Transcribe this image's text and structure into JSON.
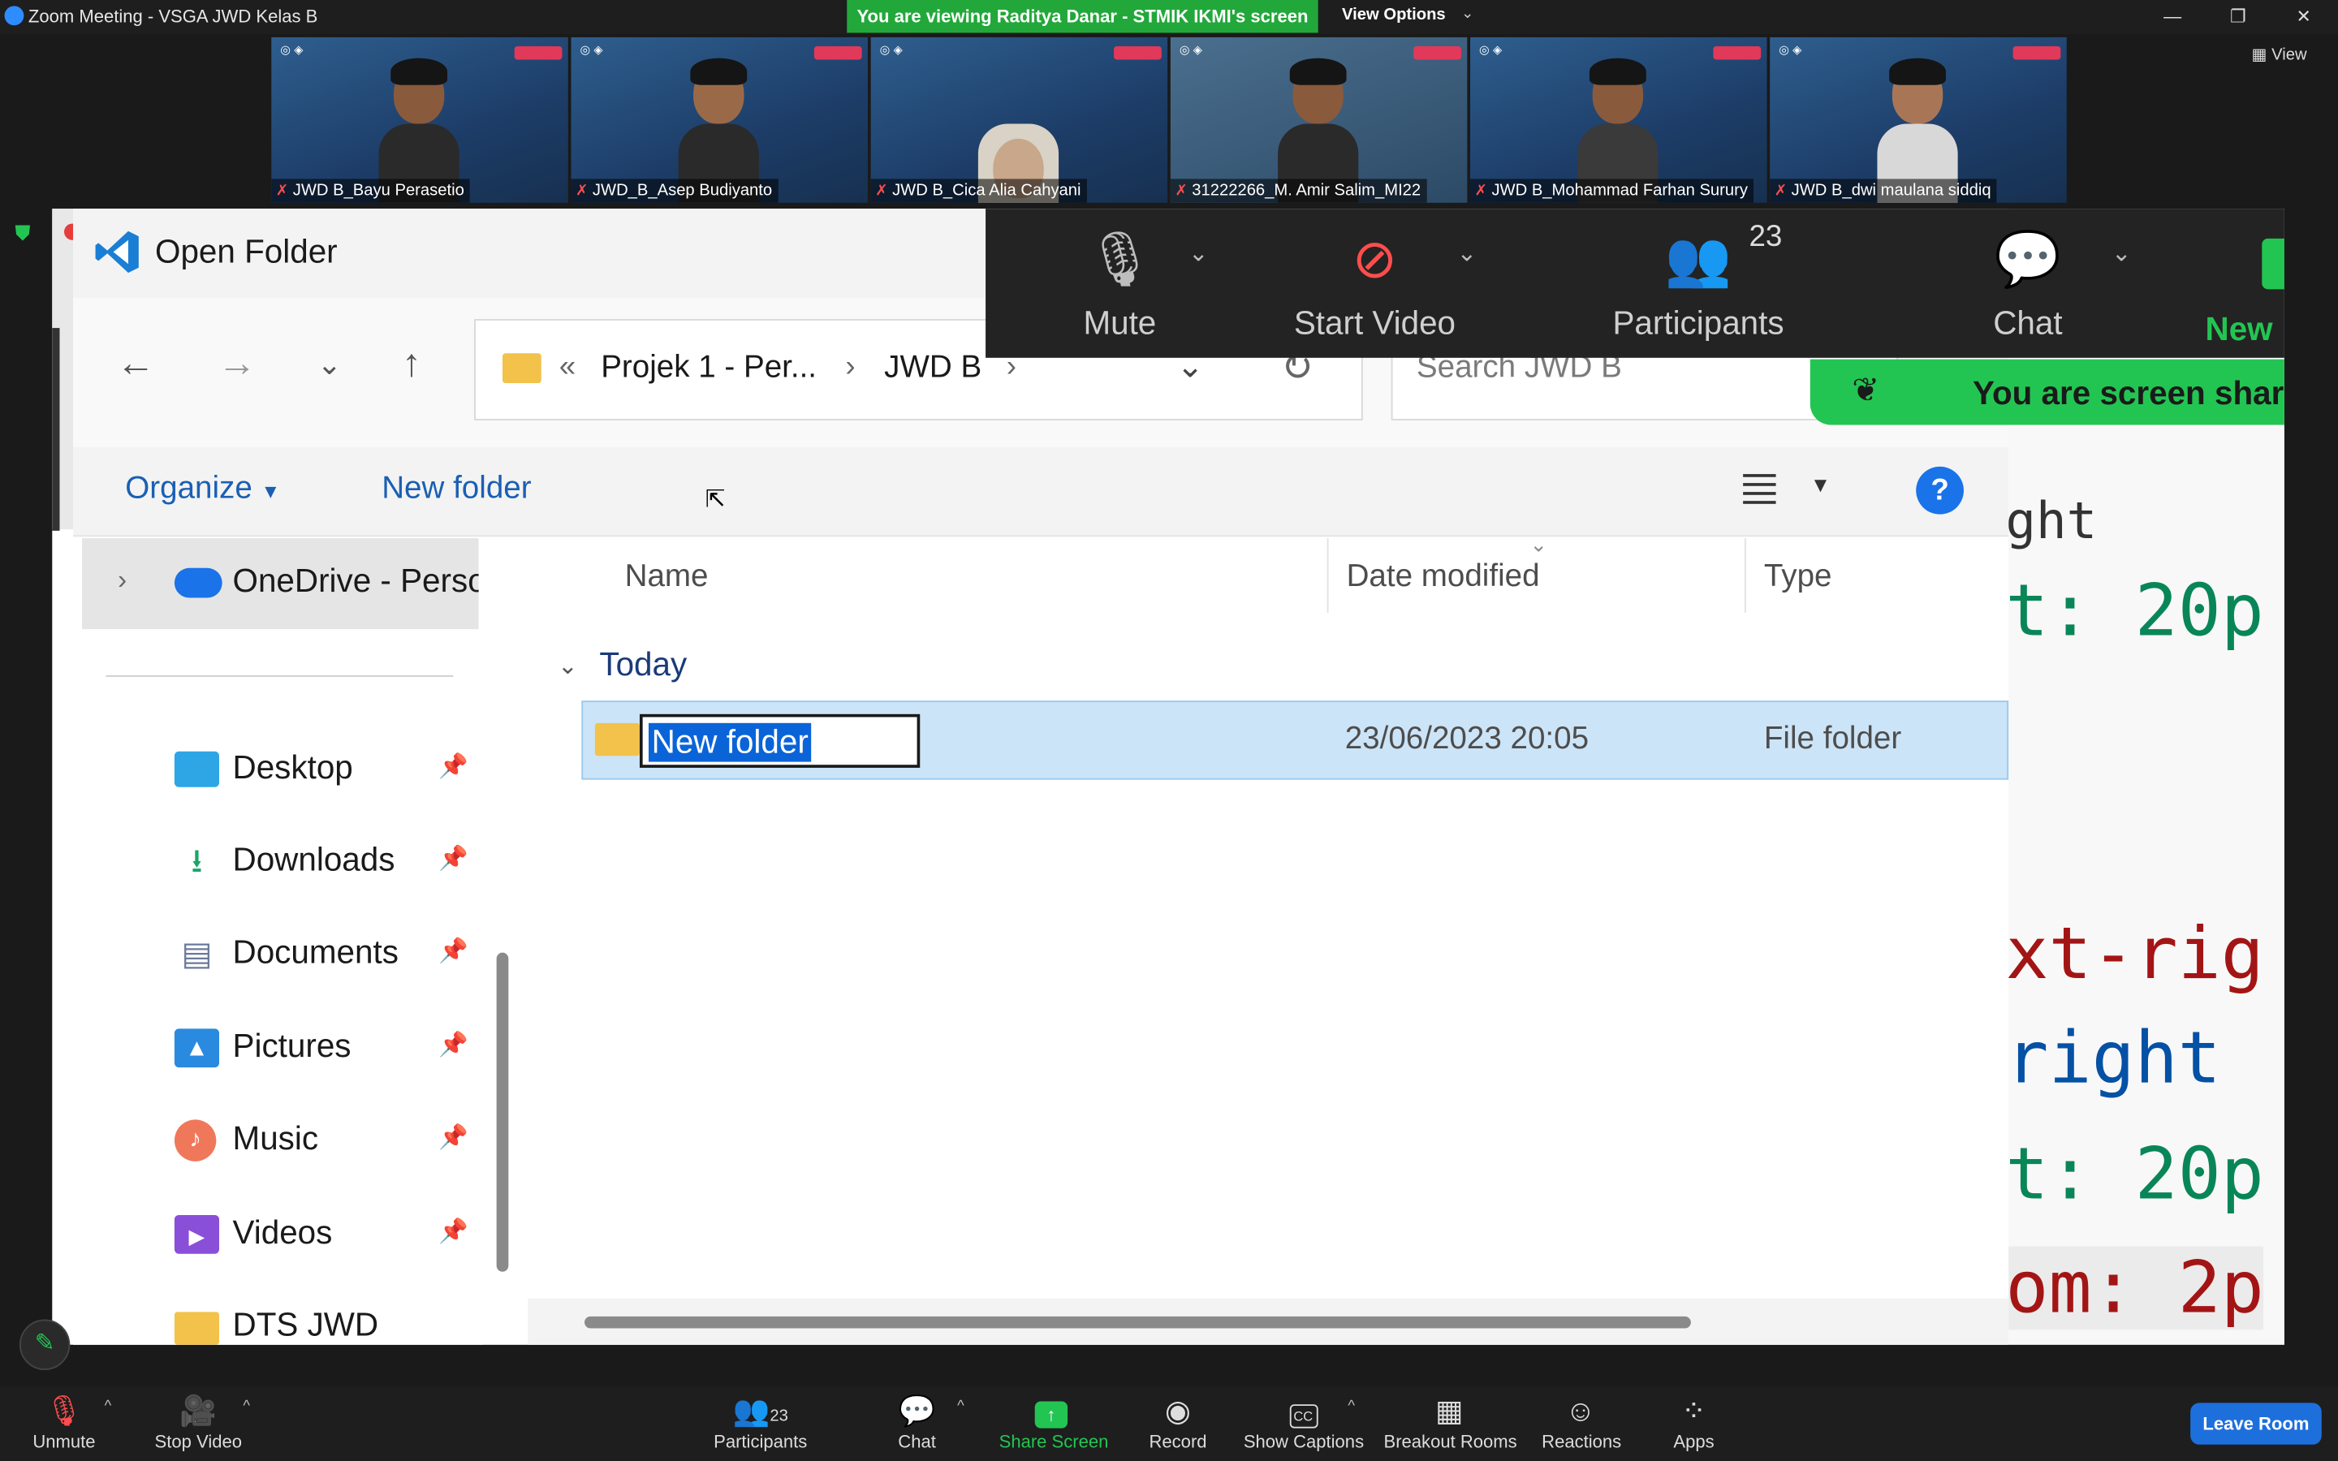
{
  "zoom": {
    "window_title": "Zoom Meeting - VSGA JWD Kelas B",
    "viewing_banner": "You are viewing Raditya Danar - STMIK IKMI's screen",
    "view_options": "View Options",
    "view_button": "View",
    "participants": [
      {
        "name": "JWD B_Bayu Perasetio"
      },
      {
        "name": "JWD_B_Asep Budiyanto"
      },
      {
        "name": "JWD B_Cica Alia Cahyani"
      },
      {
        "name": "31222266_M. Amir Salim_MI22"
      },
      {
        "name": "JWD B_Mohammad Farhan Surury"
      },
      {
        "name": "JWD B_dwi maulana siddiq"
      }
    ],
    "floating_toolbar": {
      "mute": "Mute",
      "start_video": "Start Video",
      "participants": "Participants",
      "participants_count": "23",
      "chat": "Chat",
      "new": "New"
    },
    "sharing_notice": "You are screen shar",
    "bottom_toolbar": {
      "unmute": "Unmute",
      "stop_video": "Stop Video",
      "participants": "Participants",
      "participants_count": "23",
      "chat": "Chat",
      "share_screen": "Share Screen",
      "record": "Record",
      "show_captions": "Show Captions",
      "breakout_rooms": "Breakout Rooms",
      "reactions": "Reactions",
      "apps": "Apps",
      "leave": "Leave Room"
    },
    "colors": {
      "accent_green": "#23c552",
      "leave_blue": "#1d6fdc"
    }
  },
  "dialog": {
    "title": "Open Folder",
    "address": {
      "overflow": "«",
      "segment_1": "Projek 1 - Per...",
      "segment_2": "JWD B"
    },
    "search_placeholder": "Search JWD B",
    "commands": {
      "organize": "Organize",
      "new_folder": "New folder"
    },
    "nav_pane": {
      "onedrive": "OneDrive - Personal",
      "items": [
        {
          "label": "Desktop",
          "icon": "desktop-icon"
        },
        {
          "label": "Downloads",
          "icon": "download-icon"
        },
        {
          "label": "Documents",
          "icon": "documents-icon"
        },
        {
          "label": "Pictures",
          "icon": "pictures-icon"
        },
        {
          "label": "Music",
          "icon": "music-icon"
        },
        {
          "label": "Videos",
          "icon": "videos-icon"
        },
        {
          "label": "DTS JWD",
          "icon": "folder-icon"
        }
      ]
    },
    "columns": {
      "name": "Name",
      "date_modified": "Date modified",
      "type": "Type"
    },
    "group": "Today",
    "files": [
      {
        "name": "New folder",
        "date": "23/06/2023 20:05",
        "type": "File folder"
      }
    ]
  },
  "code_peek": {
    "lines": [
      "ght",
      "t: 20p",
      "xt-rig",
      " right",
      "t: 20p",
      "om: 2p"
    ]
  }
}
